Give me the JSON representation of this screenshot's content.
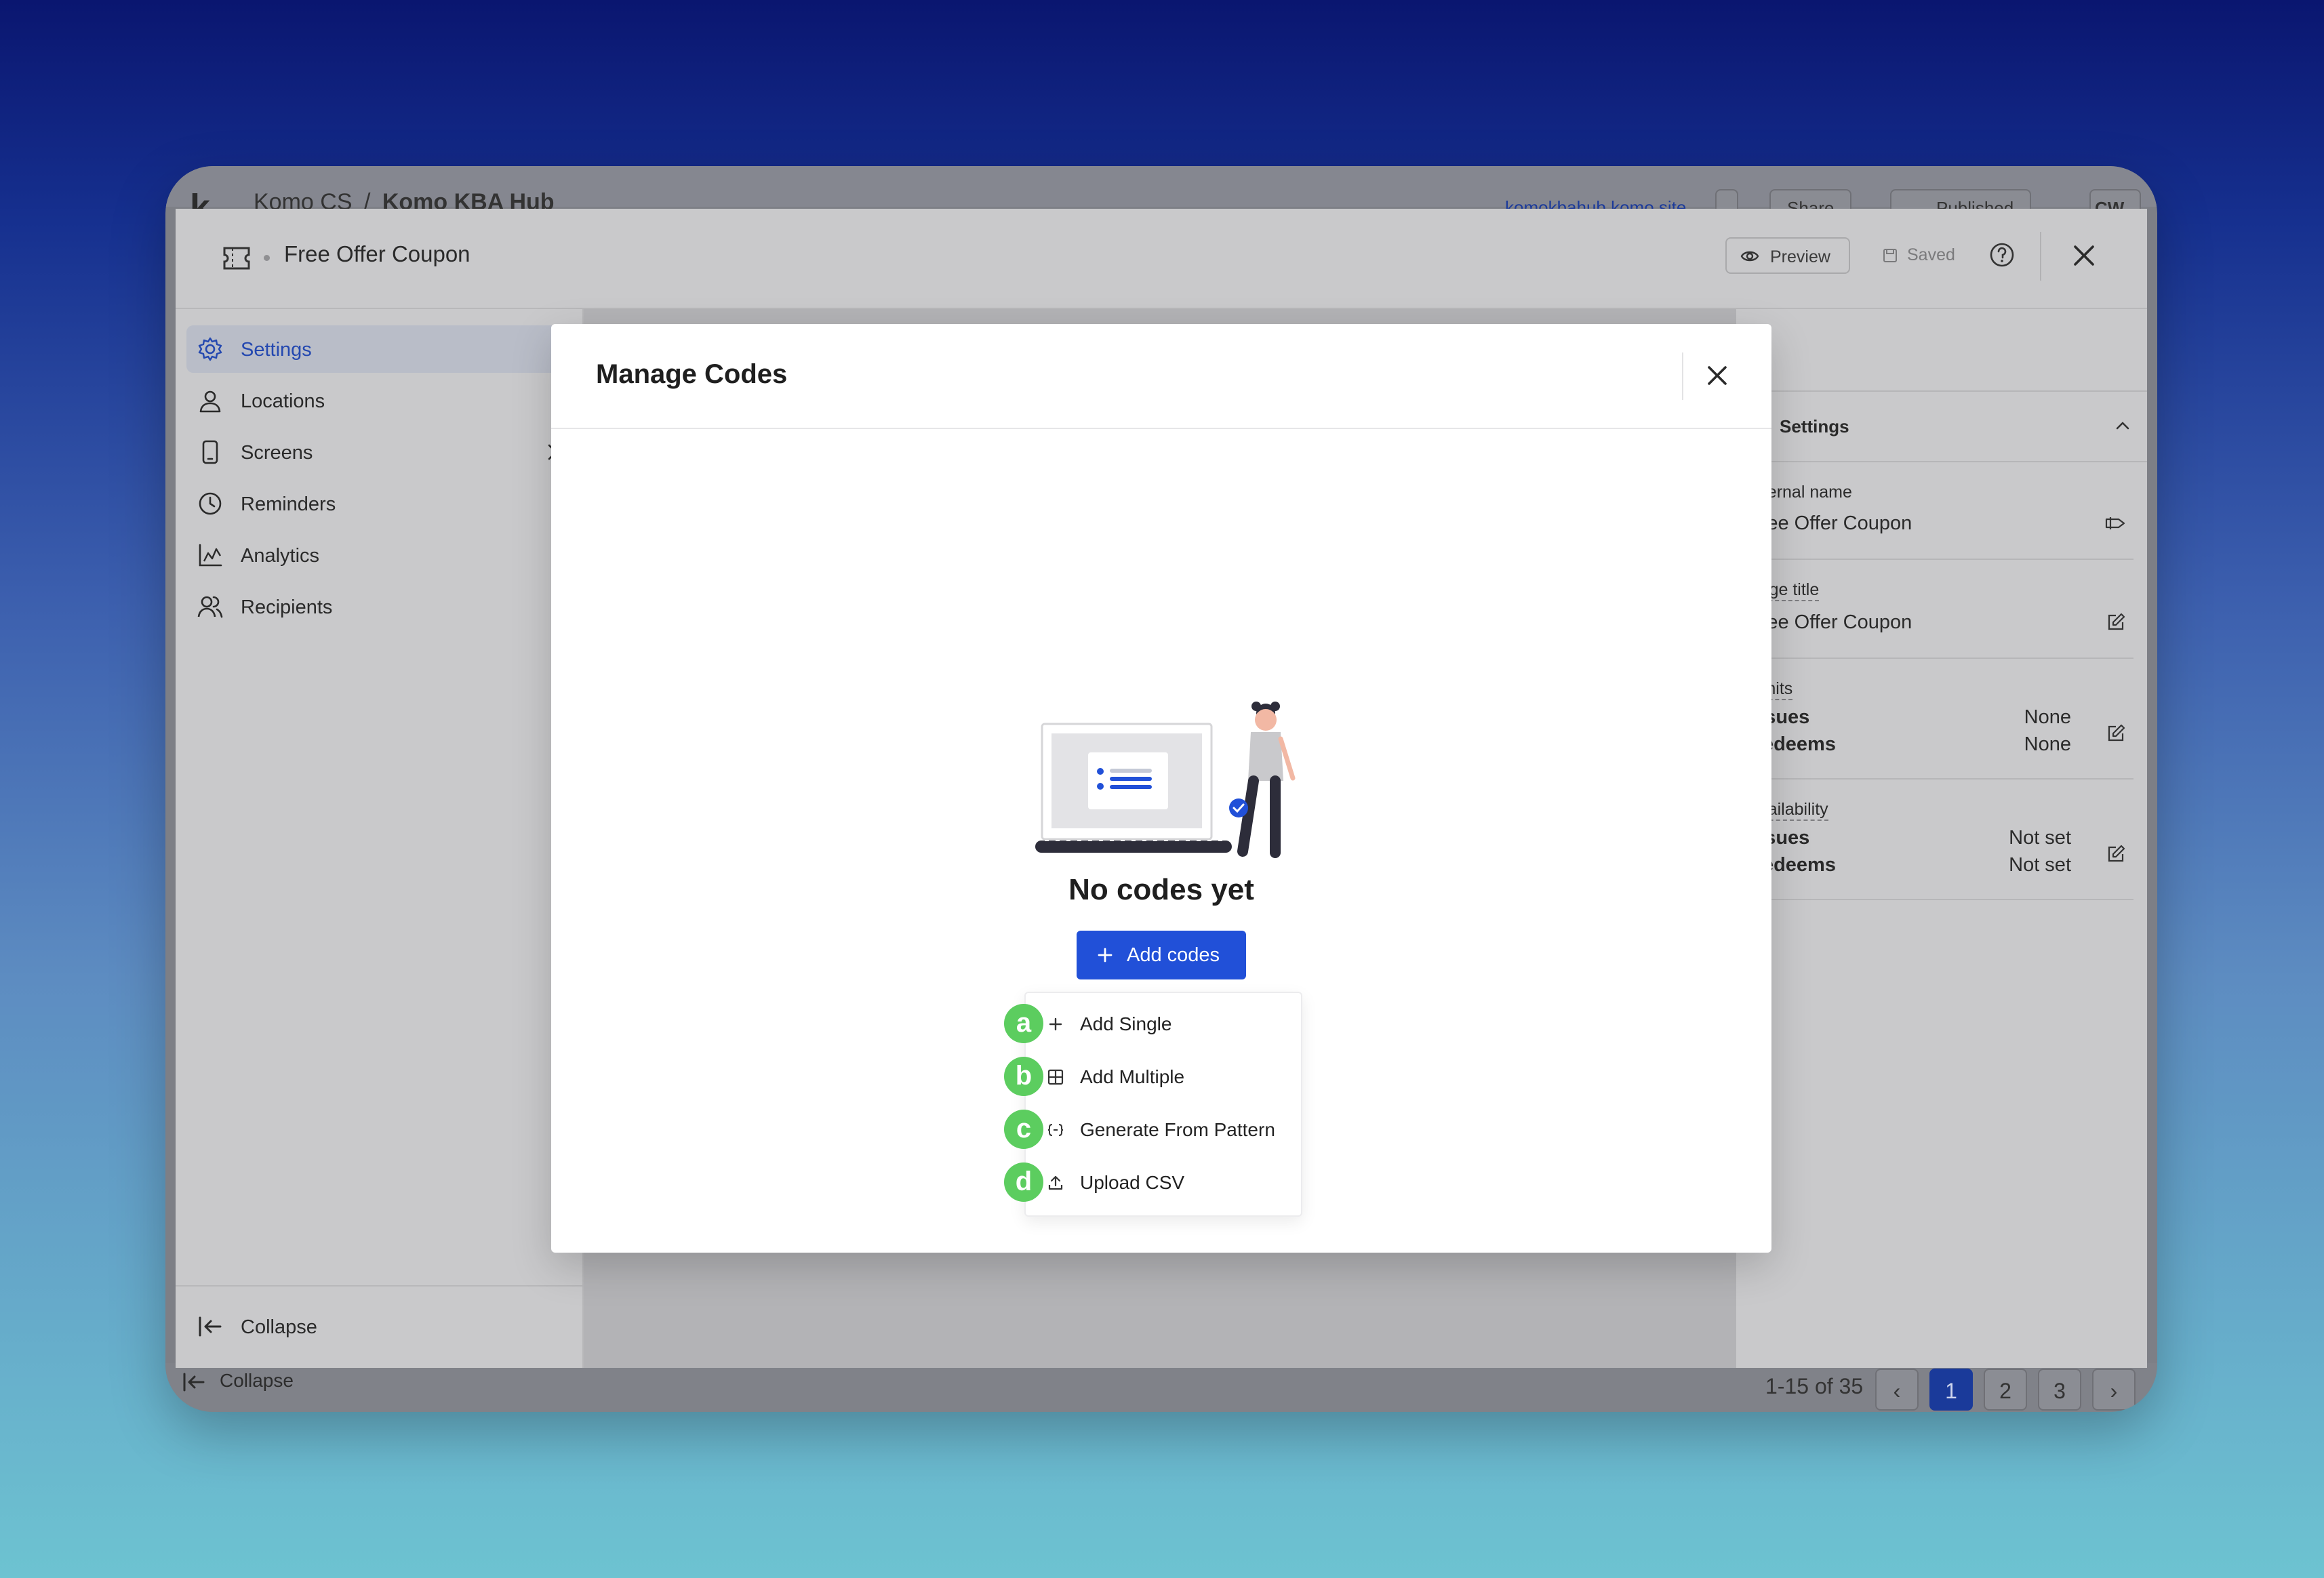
{
  "app": {
    "logo": "k",
    "breadcrumb_org": "Komo CS",
    "breadcrumb_sep": "/",
    "breadcrumb_hub": "Komo KBA Hub",
    "site_link": "komokbahub.komo.site",
    "share_label": "Share",
    "publish_status": "Published",
    "avatar": "CW",
    "bottom_collapse": "Collapse",
    "pager_info": "1-15 of 35",
    "pages": [
      "1",
      "2",
      "3"
    ],
    "active_page": "1"
  },
  "editor": {
    "title": "Free Offer Coupon",
    "preview_label": "Preview",
    "saved_label": "Saved",
    "sidebar": [
      {
        "label": "Settings",
        "icon": "gear-icon",
        "active": true
      },
      {
        "label": "Locations",
        "icon": "location-pin-icon"
      },
      {
        "label": "Screens",
        "icon": "phone-icon",
        "has_chevron": true
      },
      {
        "label": "Reminders",
        "icon": "clock-icon"
      },
      {
        "label": "Analytics",
        "icon": "chart-icon"
      },
      {
        "label": "Recipients",
        "icon": "users-icon"
      }
    ],
    "collapse_label": "Collapse",
    "settings_panel": {
      "title": "Settings",
      "internal_name_label": "Internal name",
      "internal_name_value": "Free Offer Coupon",
      "page_title_label": "Page title",
      "page_title_value": "Free Offer Coupon",
      "limits_label": "Limits",
      "limits": [
        {
          "label": "Issues",
          "value": "None"
        },
        {
          "label": "Redeems",
          "value": "None"
        }
      ],
      "availability_label": "Availability",
      "availability": [
        {
          "label": "Issues",
          "value": "Not set"
        },
        {
          "label": "Redeems",
          "value": "Not set"
        }
      ]
    }
  },
  "modal": {
    "title": "Manage Codes",
    "empty_title": "No codes yet",
    "add_button_label": "Add codes",
    "menu": [
      {
        "badge": "a",
        "label": "Add Single",
        "icon": "plus-icon"
      },
      {
        "badge": "b",
        "label": "Add Multiple",
        "icon": "grid-add-icon"
      },
      {
        "badge": "c",
        "label": "Generate From Pattern",
        "icon": "brackets-icon"
      },
      {
        "badge": "d",
        "label": "Upload CSV",
        "icon": "upload-icon"
      }
    ]
  },
  "colors": {
    "primary": "#2150d8",
    "badge": "#5ccd5f",
    "active_nav_text": "#2448b0"
  }
}
